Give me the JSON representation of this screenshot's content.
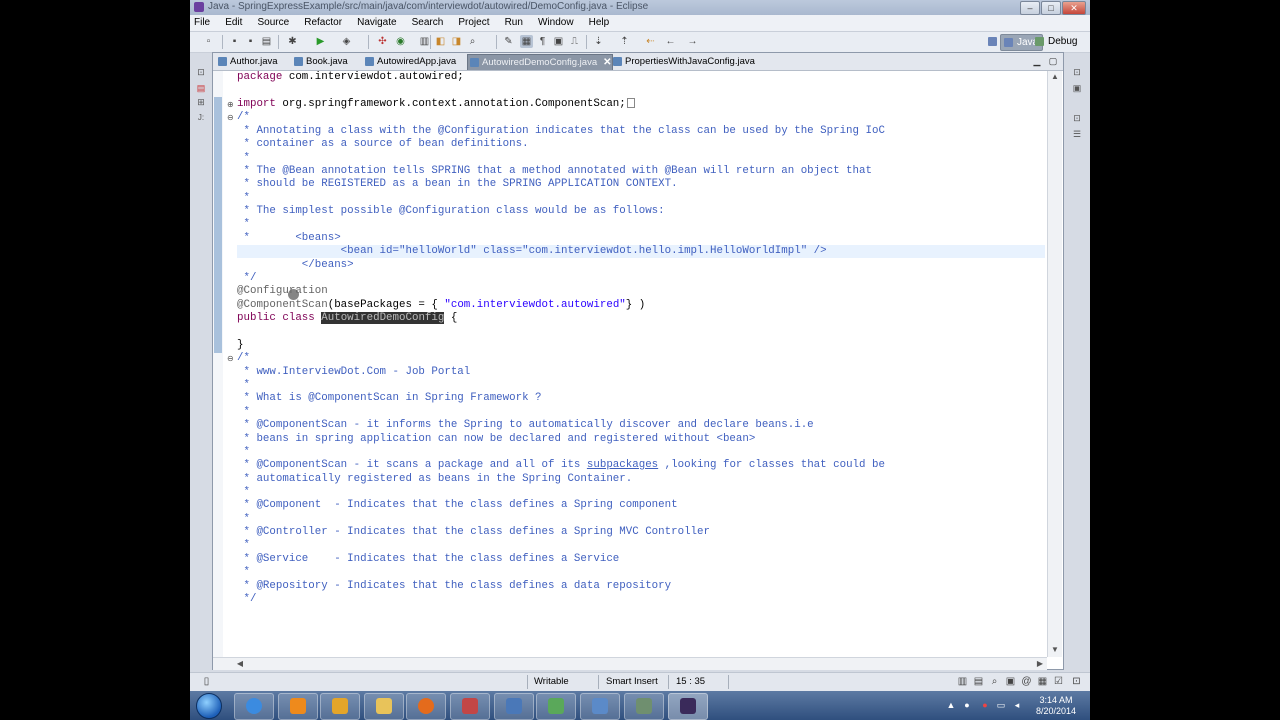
{
  "window": {
    "title": "Java - SpringExpressExample/src/main/java/com/interviewdot/autowired/DemoConfig.java - Eclipse",
    "minimize": "–",
    "maximize": "□",
    "close": "✕"
  },
  "menu": [
    "File",
    "Edit",
    "Source",
    "Refactor",
    "Navigate",
    "Search",
    "Project",
    "Run",
    "Window",
    "Help"
  ],
  "perspectives": {
    "java": "Java",
    "debug": "Debug"
  },
  "tabs": [
    {
      "label": "Author.java"
    },
    {
      "label": "Book.java"
    },
    {
      "label": "AutowiredApp.java"
    },
    {
      "label": "AutowiredDemoConfig.java",
      "close": "✕"
    },
    {
      "label": "PropertiesWithJavaConfig.java"
    }
  ],
  "code": {
    "l1_kw": "package",
    "l1_rest": " com.interviewdot.autowired;",
    "l3_kw": "import",
    "l3_rest": " org.springframework.context.annotation.ComponentScan;",
    "l4": "/*",
    "l5": " * Annotating a class with the @Configuration indicates that the class can be used by the Spring IoC",
    "l6": " * container as a source of bean definitions.",
    "l7": " *",
    "l8": " * The @Bean annotation tells SPRING that a method annotated with @Bean will return an object that",
    "l9": " * should be REGISTERED as a bean in the SPRING APPLICATION CONTEXT.",
    "l10": " *",
    "l11": " * The simplest possible @Configuration class would be as follows:",
    "l12": " *",
    "l13": " *       <beans>",
    "l14": "                <bean id=\"helloWorld\" class=\"com.interviewdot.hello.impl.HelloWorldImpl\" />",
    "l15": "          </beans>",
    "l16": " */",
    "l17": "@Configuration",
    "l18_an": "@ComponentScan",
    "l18_mid": "(basePackages = { ",
    "l18_str": "\"com.interviewdot.autowired\"",
    "l18_end": "} )",
    "l19_kw": "public class",
    "l19_sel": "AutowiredDemoConfig",
    "l19_end": " {",
    "l21": "}",
    "l22": "/*",
    "l23": " * www.InterviewDot.Com - Job Portal",
    "l24": " *",
    "l25": " * What is @ComponentScan in Spring Framework ?",
    "l26": " *",
    "l27": " * @ComponentScan - it informs the Spring to automatically discover and declare beans.i.e",
    "l28": " * beans in spring application can now be declared and registered without <bean>",
    "l29": " *",
    "l30a": " * @ComponentScan - it scans a package and all of its ",
    "l30b": "subpackages",
    "l30c": " ,looking for classes that could be",
    "l31": " * automatically registered as beans in the Spring Container.",
    "l32": " *",
    "l33": " * @Component  - Indicates that the class defines a Spring component",
    "l34": " *",
    "l35": " * @Controller - Indicates that the class defines a Spring MVC Controller",
    "l36": " *",
    "l37": " * @Service    - Indicates that the class defines a Service",
    "l38": " *",
    "l39": " * @Repository - Indicates that the class defines a data repository",
    "l40": " */"
  },
  "status": {
    "writable": "Writable",
    "insert_mode": "Smart Insert",
    "position": "15 : 35"
  },
  "clock": {
    "time": "3:14 AM",
    "date": "8/20/2014"
  },
  "colors": {
    "keyword": "#7f0055",
    "comment": "#3f5fbf",
    "annotation": "#646464",
    "string": "#2a00ff"
  }
}
